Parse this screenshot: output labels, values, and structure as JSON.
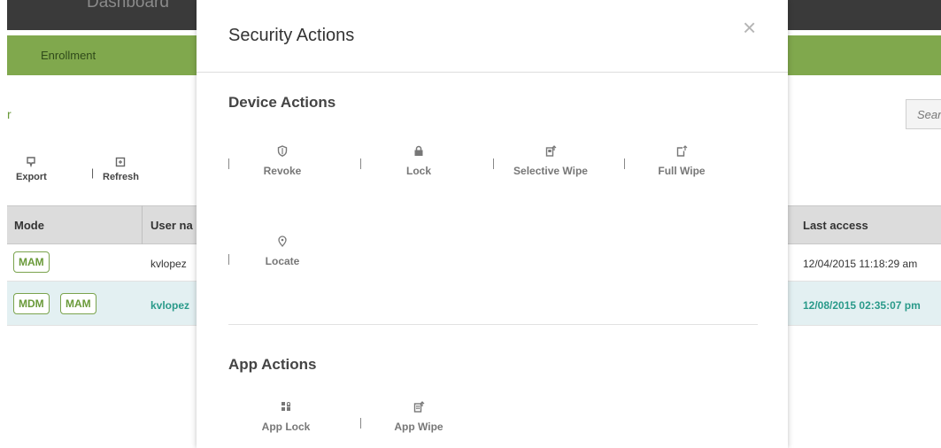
{
  "background": {
    "topbar_title": "Dashboard",
    "tab_enrollment": "Enrollment",
    "left_fragment": "r",
    "search_placeholder": "Sear",
    "toolbar": {
      "export": "Export",
      "refresh": "Refresh"
    },
    "table": {
      "headers": {
        "mode": "Mode",
        "user_name": "User na",
        "last_access": "Last access"
      },
      "rows": [
        {
          "modes": [
            "MAM"
          ],
          "user": "kvlopez",
          "last_access": "12/04/2015 11:18:29 am"
        },
        {
          "modes": [
            "MDM",
            "MAM"
          ],
          "user": "kvlopez",
          "last_access": "12/08/2015 02:35:07 pm"
        }
      ]
    }
  },
  "modal": {
    "title": "Security Actions",
    "close_glyph": "×",
    "device_section": "Device Actions",
    "device_actions": [
      {
        "label": "Revoke",
        "icon": "shield-icon"
      },
      {
        "label": "Lock",
        "icon": "lock-icon"
      },
      {
        "label": "Selective Wipe",
        "icon": "selective-wipe-icon"
      },
      {
        "label": "Full Wipe",
        "icon": "full-wipe-icon"
      },
      {
        "label": "Locate",
        "icon": "location-pin-icon"
      }
    ],
    "app_section": "App Actions",
    "app_actions": [
      {
        "label": "App Lock",
        "icon": "app-lock-icon"
      },
      {
        "label": "App Wipe",
        "icon": "app-wipe-icon"
      }
    ]
  },
  "colors": {
    "topbar": "#3a3a3a",
    "green_bar": "#80a84d",
    "badge_green": "#6a9a3a",
    "teal_text": "#2a9a8a",
    "selected_row": "#e3f0f2"
  }
}
